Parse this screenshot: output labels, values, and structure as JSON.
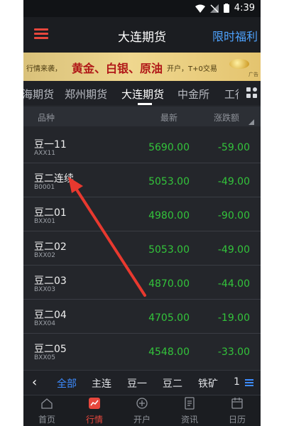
{
  "status_bar": {
    "time": "4:39"
  },
  "header": {
    "title": "大连期货",
    "promo": "限时福利"
  },
  "banner": {
    "prefix": "行情来袭，",
    "metals": "黄金、白银、原油",
    "suffix": "开户，T+0交易",
    "ad_tag": "广告"
  },
  "tabs": [
    {
      "label": "海期货"
    },
    {
      "label": "郑州期货"
    },
    {
      "label": "大连期货",
      "active": true
    },
    {
      "label": "中金所"
    },
    {
      "label": "工行"
    }
  ],
  "columns": {
    "name": "品种",
    "price": "最新",
    "change": "涨跌额"
  },
  "rows": [
    {
      "name": "豆一11",
      "code": "AXX11",
      "price": "5690.00",
      "change": "-59.00"
    },
    {
      "name": "豆二连续",
      "code": "B0001",
      "price": "5053.00",
      "change": "-49.00"
    },
    {
      "name": "豆二01",
      "code": "BXX01",
      "price": "4980.00",
      "change": "-90.00"
    },
    {
      "name": "豆二02",
      "code": "BXX02",
      "price": "5053.00",
      "change": "-49.00"
    },
    {
      "name": "豆二03",
      "code": "BXX03",
      "price": "4870.00",
      "change": "-44.00"
    },
    {
      "name": "豆二04",
      "code": "BXX04",
      "price": "4705.00",
      "change": "-19.00"
    },
    {
      "name": "豆二05",
      "code": "BXX05",
      "price": "4548.00",
      "change": "-33.00"
    }
  ],
  "subtabs": [
    "全部",
    "主连",
    "豆一",
    "豆二",
    "铁矿",
    "1"
  ],
  "bottom_nav": [
    {
      "label": "首页",
      "icon": "home-icon"
    },
    {
      "label": "行情",
      "icon": "chart-icon",
      "active": true
    },
    {
      "label": "开户",
      "icon": "plus-circle-icon"
    },
    {
      "label": "资讯",
      "icon": "document-icon"
    },
    {
      "label": "日历",
      "icon": "calendar-icon"
    }
  ],
  "colors": {
    "accent_red": "#e7473d",
    "price_green": "#33c43b",
    "link_blue": "#3d8cff",
    "background": "#24262b"
  },
  "annotation": {
    "type": "red-arrow",
    "target": "豆二连续"
  }
}
